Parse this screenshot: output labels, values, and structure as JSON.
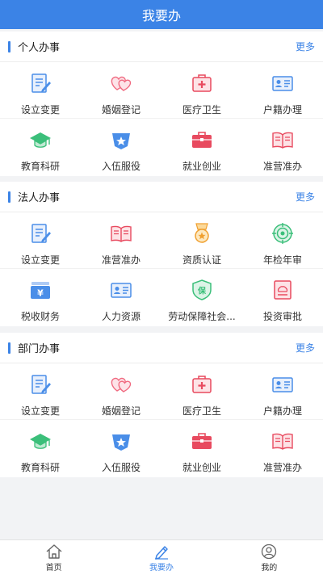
{
  "header": {
    "title": "我要办"
  },
  "sections": [
    {
      "title": "个人办事",
      "more": "更多",
      "items": [
        {
          "label": "设立变更",
          "icon": "form-edit-icon"
        },
        {
          "label": "婚姻登记",
          "icon": "hearts-icon"
        },
        {
          "label": "医疗卫生",
          "icon": "medical-kit-icon"
        },
        {
          "label": "户籍办理",
          "icon": "id-card-icon"
        },
        {
          "label": "教育科研",
          "icon": "graduation-cap-icon"
        },
        {
          "label": "入伍服役",
          "icon": "military-badge-icon"
        },
        {
          "label": "就业创业",
          "icon": "briefcase-icon"
        },
        {
          "label": "准营准办",
          "icon": "open-book-icon"
        }
      ]
    },
    {
      "title": "法人办事",
      "more": "更多",
      "items": [
        {
          "label": "设立变更",
          "icon": "form-edit-icon"
        },
        {
          "label": "准营准办",
          "icon": "open-book-icon"
        },
        {
          "label": "资质认证",
          "icon": "medal-icon"
        },
        {
          "label": "年检年审",
          "icon": "target-icon"
        },
        {
          "label": "税收财务",
          "icon": "money-stack-icon"
        },
        {
          "label": "人力资源",
          "icon": "id-card-icon"
        },
        {
          "label": "劳动保障社会...",
          "icon": "shield-icon"
        },
        {
          "label": "投资审批",
          "icon": "approval-document-icon"
        }
      ]
    },
    {
      "title": "部门办事",
      "more": "更多",
      "items": [
        {
          "label": "设立变更",
          "icon": "form-edit-icon"
        },
        {
          "label": "婚姻登记",
          "icon": "hearts-icon"
        },
        {
          "label": "医疗卫生",
          "icon": "medical-kit-icon"
        },
        {
          "label": "户籍办理",
          "icon": "id-card-icon"
        },
        {
          "label": "教育科研",
          "icon": "graduation-cap-icon"
        },
        {
          "label": "入伍服役",
          "icon": "military-badge-icon"
        },
        {
          "label": "就业创业",
          "icon": "briefcase-icon"
        },
        {
          "label": "准营准办",
          "icon": "open-book-icon"
        }
      ]
    }
  ],
  "shield_char": "保",
  "tabbar": {
    "tabs": [
      {
        "label": "首页",
        "icon": "home-icon",
        "active": false
      },
      {
        "label": "我要办",
        "icon": "pencil-icon",
        "active": true
      },
      {
        "label": "我的",
        "icon": "user-icon",
        "active": false
      }
    ]
  },
  "colors": {
    "accent": "#3b83e6",
    "icon_blue": "#4a8ee8",
    "icon_pink": "#f06a80",
    "icon_red": "#e84a5f",
    "icon_green": "#3bbf7a",
    "icon_orange": "#f0a030",
    "icon_purple": "#8f86e6"
  }
}
